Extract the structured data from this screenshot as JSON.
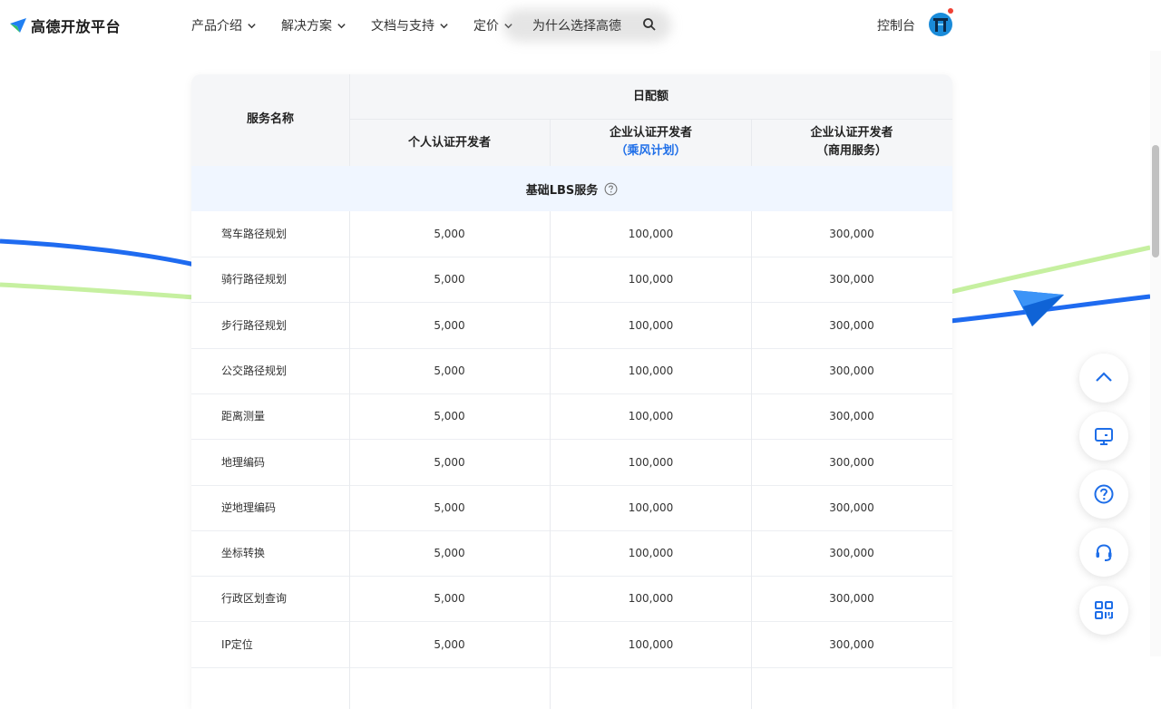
{
  "header": {
    "logo_text": "高德开放平台",
    "nav": [
      {
        "label": "产品介绍"
      },
      {
        "label": "解决方案"
      },
      {
        "label": "文档与支持"
      },
      {
        "label": "定价"
      }
    ],
    "why_label": "为什么选择高德",
    "console_label": "控制台"
  },
  "table": {
    "col_service": "服务名称",
    "col_daily_quota": "日配额",
    "col_personal": "个人认证开发者",
    "col_enterprise_line1": "企业认证开发者",
    "col_enterprise_plan": "（乘风计划）",
    "col_commercial_line1": "企业认证开发者",
    "col_commercial_plan": "（商用服务）",
    "section_title": "基础LBS服务",
    "rows": [
      {
        "name": "驾车路径规划",
        "personal": "5,000",
        "enterprise": "100,000",
        "commercial": "300,000"
      },
      {
        "name": "骑行路径规划",
        "personal": "5,000",
        "enterprise": "100,000",
        "commercial": "300,000"
      },
      {
        "name": "步行路径规划",
        "personal": "5,000",
        "enterprise": "100,000",
        "commercial": "300,000"
      },
      {
        "name": "公交路径规划",
        "personal": "5,000",
        "enterprise": "100,000",
        "commercial": "300,000"
      },
      {
        "name": "距离测量",
        "personal": "5,000",
        "enterprise": "100,000",
        "commercial": "300,000"
      },
      {
        "name": "地理编码",
        "personal": "5,000",
        "enterprise": "100,000",
        "commercial": "300,000"
      },
      {
        "name": "逆地理编码",
        "personal": "5,000",
        "enterprise": "100,000",
        "commercial": "300,000"
      },
      {
        "name": "坐标转换",
        "personal": "5,000",
        "enterprise": "100,000",
        "commercial": "300,000"
      },
      {
        "name": "行政区划查询",
        "personal": "5,000",
        "enterprise": "100,000",
        "commercial": "300,000"
      },
      {
        "name": "IP定位",
        "personal": "5,000",
        "enterprise": "100,000",
        "commercial": "300,000"
      }
    ]
  },
  "floating": [
    "chevron-up-icon",
    "monitor-icon",
    "help-icon",
    "headset-icon",
    "qrcode-icon"
  ],
  "colors": {
    "accent": "#1e6ee8",
    "line_blue": "#1f6bf0",
    "line_green": "#c6f0a0",
    "header_bg": "#f5f6f8",
    "section_bg": "#f0f6ff"
  }
}
